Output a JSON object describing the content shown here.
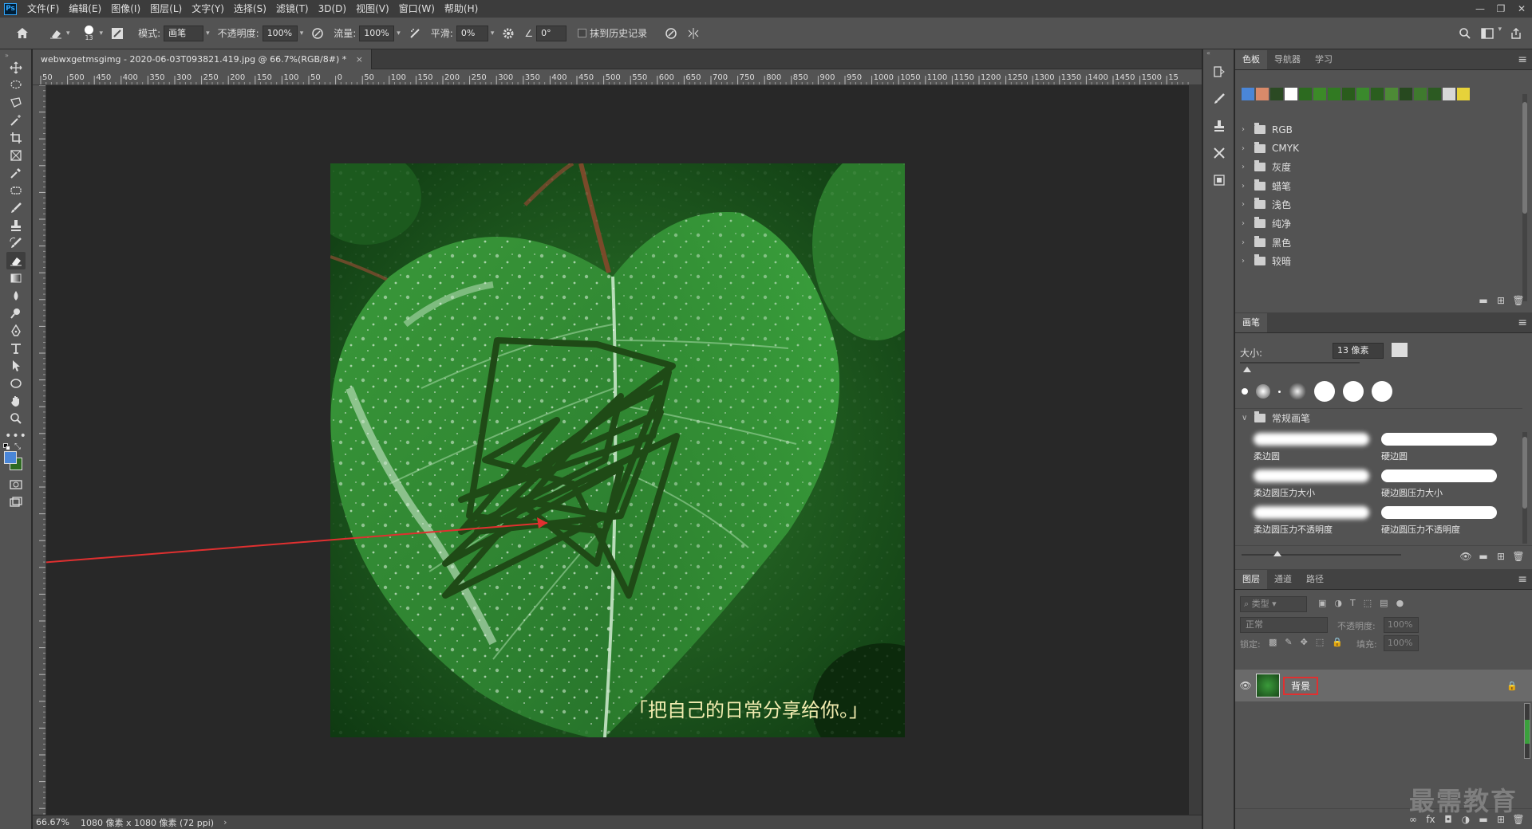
{
  "menu": {
    "app_logo": "Ps",
    "items": [
      "文件(F)",
      "编辑(E)",
      "图像(I)",
      "图层(L)",
      "文字(Y)",
      "选择(S)",
      "滤镜(T)",
      "3D(D)",
      "视图(V)",
      "窗口(W)",
      "帮助(H)"
    ],
    "window_controls": [
      "—",
      "❐",
      "✕"
    ]
  },
  "options": {
    "brush_size": "13",
    "mode_label": "模式:",
    "mode_value": "画笔",
    "opacity_label": "不透明度:",
    "opacity_value": "100%",
    "flow_label": "流量:",
    "flow_value": "100%",
    "smooth_label": "平滑:",
    "smooth_value": "0%",
    "angle_value": "0°",
    "erase_history_label": "抹到历史记录"
  },
  "document": {
    "tab_title": "webwxgetmsgimg - 2020-06-03T093821.419.jpg @ 66.7%(RGB/8#) *",
    "caption": "「把自己的日常分享给你。」"
  },
  "ruler_top_labels": [
    "50",
    "500",
    "450",
    "400",
    "350",
    "300",
    "250",
    "200",
    "150",
    "100",
    "50",
    "0",
    "50",
    "100",
    "150",
    "200",
    "250",
    "300",
    "350",
    "400",
    "450",
    "500",
    "550",
    "600",
    "650",
    "700",
    "750",
    "800",
    "850",
    "900",
    "950",
    "1000",
    "1050",
    "1100",
    "1150",
    "1200",
    "1250",
    "1300",
    "1350",
    "1400",
    "1450",
    "1500",
    "15"
  ],
  "status": {
    "zoom": "66.67%",
    "doc_size": "1080 像素 x 1080 像素 (72 ppi)"
  },
  "swatches_panel": {
    "tabs": [
      "色板",
      "导航器",
      "学习"
    ],
    "colors": [
      "#4a86d8",
      "#d98a6a",
      "#2b4a23",
      "#ffffff",
      "#2c6a1f",
      "#3c8a28",
      "#317a22",
      "#2a5c1c",
      "#3a8a2c",
      "#2a5e1e",
      "#4d8a36",
      "#27491f",
      "#3f7a2e",
      "#2c5a22",
      "#d8d8d8",
      "#e6d23a"
    ],
    "groups": [
      "RGB",
      "CMYK",
      "灰度",
      "蜡笔",
      "浅色",
      "纯净",
      "黑色",
      "较暗"
    ]
  },
  "brush_panel": {
    "tab": "画笔",
    "size_label": "大小:",
    "size_value": "13 像素",
    "group_name": "常规画笔",
    "brushes": [
      "柔边圆",
      "硬边圆",
      "柔边圆压力大小",
      "硬边圆压力大小",
      "柔边圆压力不透明度",
      "硬边圆压力不透明度"
    ]
  },
  "layers_panel": {
    "tabs": [
      "图层",
      "通道",
      "路径"
    ],
    "search_placeholder": "类型",
    "blend_mode": "正常",
    "opacity_label": "不透明度:",
    "opacity_value": "100%",
    "lock_label": "锁定:",
    "fill_label": "填充:",
    "fill_value": "100%",
    "layer_name": "背景"
  },
  "watermark": "最需教育",
  "colors": {
    "foreground": "#4a86d8",
    "background": "#2e6a22",
    "highlight_red": "#e03030",
    "scribble": "#1f4a16"
  }
}
